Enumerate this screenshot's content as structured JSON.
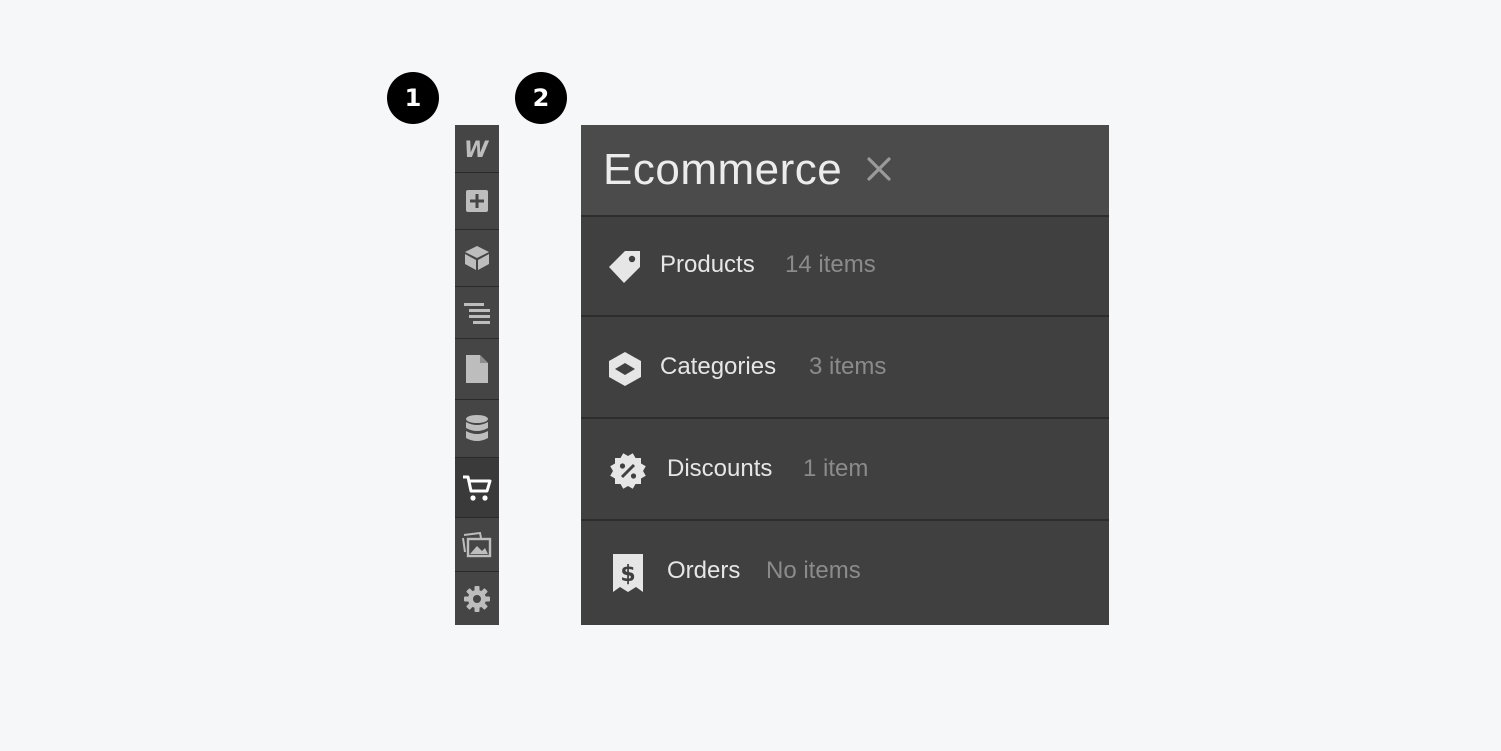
{
  "callouts": [
    "1",
    "2"
  ],
  "toolbar": {
    "items": [
      {
        "icon": "webflow-logo-icon"
      },
      {
        "icon": "add-panel-icon"
      },
      {
        "icon": "symbols-cube-icon"
      },
      {
        "icon": "navigator-icon"
      },
      {
        "icon": "pages-icon"
      },
      {
        "icon": "cms-database-icon"
      },
      {
        "icon": "ecommerce-cart-icon",
        "active": true
      },
      {
        "icon": "assets-images-icon"
      },
      {
        "icon": "settings-gear-icon"
      }
    ]
  },
  "panel": {
    "title": "Ecommerce",
    "rows": [
      {
        "icon": "tag-icon",
        "label": "Products",
        "count": "14 items"
      },
      {
        "icon": "category-box-icon",
        "label": "Categories",
        "count": "3 items"
      },
      {
        "icon": "discount-badge-icon",
        "label": "Discounts",
        "count": "1 item"
      },
      {
        "icon": "receipt-dollar-icon",
        "label": "Orders",
        "count": "No items"
      }
    ]
  },
  "colors": {
    "background": "#f6f7f9",
    "panel": "#404040",
    "header": "#4b4b4b",
    "icon": "#bdbdbd",
    "active_icon": "#ffffff"
  }
}
